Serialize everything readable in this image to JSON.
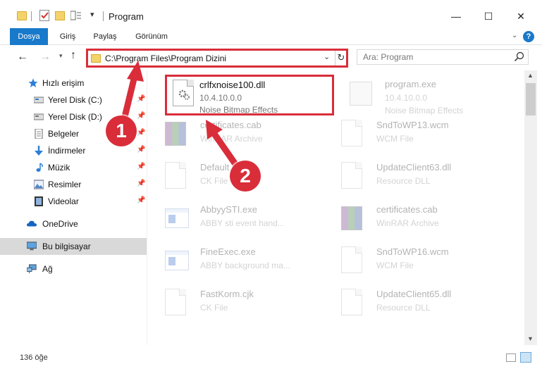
{
  "window": {
    "title": "Program",
    "minimize_glyph": "—",
    "maximize_glyph": "☐",
    "close_glyph": "✕"
  },
  "ribbon": {
    "tabs": [
      "Dosya",
      "Giriş",
      "Paylaş",
      "Görünüm"
    ]
  },
  "address": {
    "path": "C:\\Program Files\\Program Dizini",
    "refresh_glyph": "↻",
    "dropdown_glyph": "⌄"
  },
  "search": {
    "placeholder": "Ara: Program"
  },
  "sidebar": {
    "items": [
      {
        "label": "Hızlı erişim",
        "icon": "star-icon"
      },
      {
        "label": "Yerel Disk (C:)",
        "icon": "drive-icon",
        "pinned": true
      },
      {
        "label": "Yerel Disk (D:)",
        "icon": "drive-icon",
        "pinned": true
      },
      {
        "label": "Belgeler",
        "icon": "documents-icon",
        "pinned": true
      },
      {
        "label": "İndirmeler",
        "icon": "download-icon",
        "pinned": true
      },
      {
        "label": "Müzik",
        "icon": "music-icon",
        "pinned": true
      },
      {
        "label": "Resimler",
        "icon": "pictures-icon",
        "pinned": true
      },
      {
        "label": "Videolar",
        "icon": "videos-icon",
        "pinned": true
      },
      {
        "label": "OneDrive",
        "icon": "cloud-icon"
      },
      {
        "label": "Bu bilgisayar",
        "icon": "computer-icon",
        "selected": true
      },
      {
        "label": "Ağ",
        "icon": "network-icon"
      }
    ]
  },
  "files": [
    {
      "name": "crlfxnoise100.dll",
      "ver": "10.4.10.0.0",
      "desc": "Noise Bitmap Effects",
      "icon": "dll-gear-icon",
      "highlighted": true
    },
    {
      "name": "program.exe",
      "ver": "10.4.10.0.0",
      "desc": "Noise Bitmap Effects",
      "icon": "exe-icon"
    },
    {
      "name": "certificates.cab",
      "ver": "",
      "desc": "WinRAR Archive",
      "icon": "winrar-icon"
    },
    {
      "name": "SndToWP13.wcm",
      "ver": "",
      "desc": "WCM File",
      "icon": "document-icon"
    },
    {
      "name": "Default.ctk",
      "ver": "",
      "desc": "CK File",
      "icon": "document-icon"
    },
    {
      "name": "UpdateClient63.dll",
      "ver": "",
      "desc": "Resource DLL",
      "icon": "dll-gear-icon"
    },
    {
      "name": "AbbyySTI.exe",
      "ver": "",
      "desc": "ABBY sti event hand...",
      "icon": "app-icon"
    },
    {
      "name": "certificates.cab",
      "ver": "",
      "desc": "WinRAR Archive",
      "icon": "winrar-icon"
    },
    {
      "name": "FineExec.exe",
      "ver": "",
      "desc": "ABBY background ma...",
      "icon": "app-icon"
    },
    {
      "name": "SndToWP16.wcm",
      "ver": "",
      "desc": "WCM File",
      "icon": "document-icon"
    },
    {
      "name": "FastKorm.cjk",
      "ver": "",
      "desc": "CK File",
      "icon": "document-icon"
    },
    {
      "name": "UpdateClient65.dll",
      "ver": "",
      "desc": "Resource DLL",
      "icon": "dll-gear-icon"
    }
  ],
  "status": {
    "count": "136 öğe"
  },
  "annotations": {
    "step1": "1",
    "step2": "2",
    "color": "#d92d3a"
  }
}
